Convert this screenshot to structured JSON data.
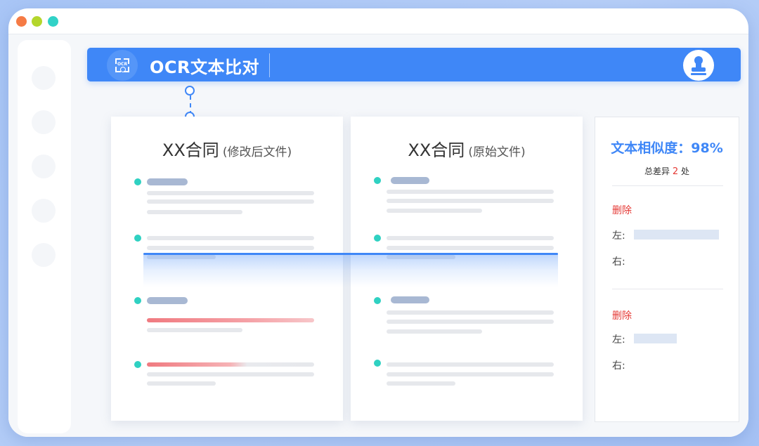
{
  "app": {
    "title": "OCR文本比对",
    "icon_label": "OCR",
    "accent_color": "#3f87f7"
  },
  "window_controls": [
    "close",
    "minimize",
    "maximize"
  ],
  "documents": [
    {
      "title": "XX合同",
      "subtitle": "(修改后文件)"
    },
    {
      "title": "XX合同",
      "subtitle": "(原始文件)"
    }
  ],
  "result": {
    "similarity_label": "文本相似度：",
    "similarity_value": "98%",
    "diff_prefix": "总差异",
    "diff_count": "2",
    "diff_suffix": "处",
    "diffs": [
      {
        "type": "删除",
        "left_label": "左:",
        "right_label": "右:"
      },
      {
        "type": "删除",
        "left_label": "左:",
        "right_label": "右:"
      }
    ]
  },
  "colors": {
    "bullet": "#2fd1c2",
    "delete": "#e53935",
    "background": "#a9c6f6"
  }
}
